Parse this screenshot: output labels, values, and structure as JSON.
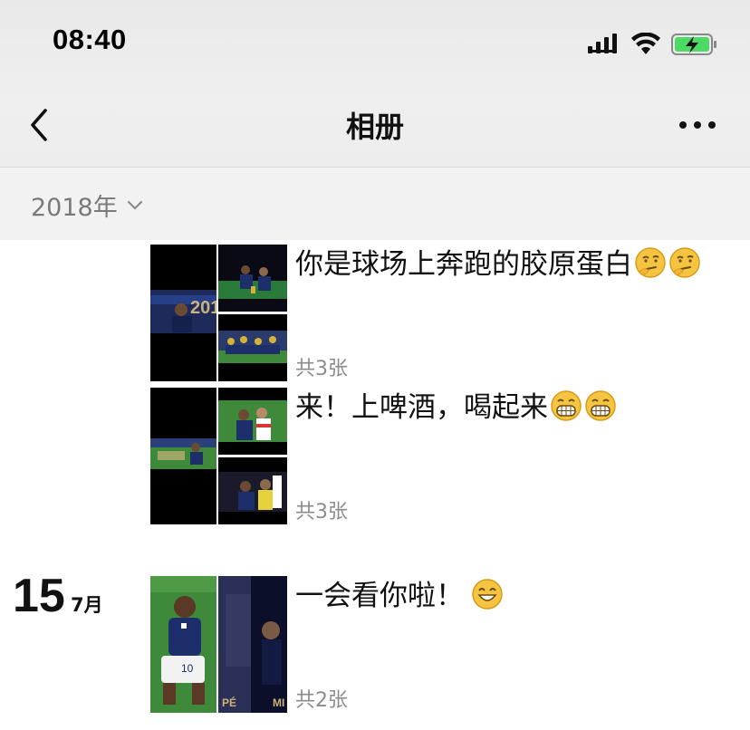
{
  "status": {
    "time": "08:40"
  },
  "nav": {
    "title": "相册"
  },
  "year_selector": {
    "label": "2018年"
  },
  "posts": [
    {
      "text": "你是球场上奔跑的胶原蛋白",
      "count": "共3张",
      "emoji": "thinking-face-icon"
    },
    {
      "text": "来！上啤酒，喝起来",
      "count": "共3张",
      "emoji": "grinning-face-icon"
    },
    {
      "text": "一会看你啦！",
      "count": "共2张",
      "emoji": "smiling-face-icon"
    }
  ],
  "date_group": {
    "day": "15",
    "month": "7月"
  },
  "colors": {
    "header_bg": "#efefef",
    "year_bar": "#f2f2f2",
    "muted_text": "#8c8c8c",
    "pitch_green": "#3e8a3a",
    "france_blue": "#1c2f6b"
  }
}
